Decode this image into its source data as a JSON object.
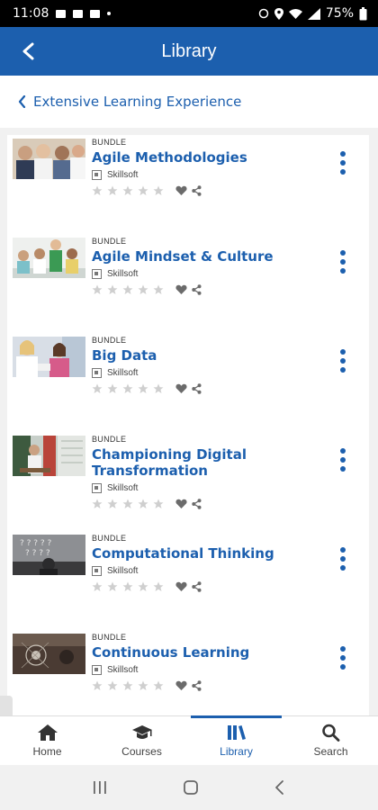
{
  "status": {
    "time": "11:08",
    "battery": "75%"
  },
  "header": {
    "title": "Library"
  },
  "breadcrumb": {
    "label": "Extensive Learning Experience"
  },
  "items": [
    {
      "type": "BUNDLE",
      "title": "Agile Methodologies",
      "provider": "Skillsoft"
    },
    {
      "type": "BUNDLE",
      "title": "Agile Mindset & Culture",
      "provider": "Skillsoft"
    },
    {
      "type": "BUNDLE",
      "title": "Big Data",
      "provider": "Skillsoft"
    },
    {
      "type": "BUNDLE",
      "title": "Championing Digital Transformation",
      "provider": "Skillsoft"
    },
    {
      "type": "BUNDLE",
      "title": "Computational Thinking",
      "provider": "Skillsoft"
    },
    {
      "type": "BUNDLE",
      "title": "Continuous Learning",
      "provider": "Skillsoft"
    }
  ],
  "nav": [
    {
      "label": "Home",
      "icon": "home-icon"
    },
    {
      "label": "Courses",
      "icon": "graduation-cap-icon"
    },
    {
      "label": "Library",
      "icon": "books-icon",
      "active": true
    },
    {
      "label": "Search",
      "icon": "search-icon"
    }
  ],
  "colors": {
    "brand": "#1c5fae",
    "statusbar": "#000000"
  }
}
